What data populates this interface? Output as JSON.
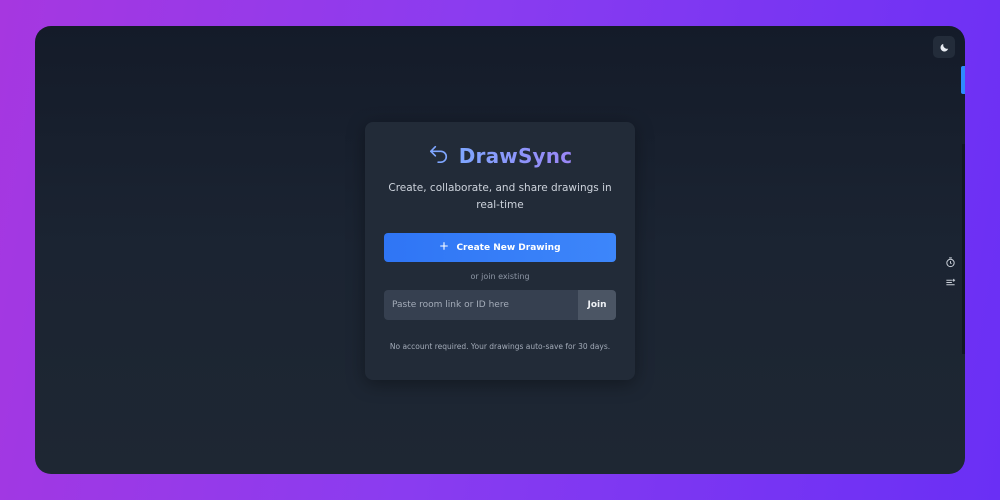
{
  "app": {
    "name": "DrawSync",
    "tagline": "Create, collaborate, and share drawings in real-time"
  },
  "actions": {
    "create_label": "Create New Drawing",
    "or_join": "or join existing",
    "room_placeholder": "Paste room link or ID here",
    "room_value": "",
    "join_label": "Join"
  },
  "footer": {
    "note": "No account required. Your drawings auto-save for 30 days."
  },
  "icons": {
    "logo": "undo-arrow-icon",
    "theme": "moon-icon",
    "create": "plus-icon",
    "side_tools": [
      "timer-icon",
      "list-settings-icon"
    ]
  },
  "colors": {
    "accent": "#3d86fa",
    "brand_gradient_start": "#7fa6ff",
    "brand_gradient_end": "#9a86f6",
    "card_bg": "#222b38",
    "backdrop_start": "#a637e0",
    "backdrop_end": "#6a2ff5"
  }
}
